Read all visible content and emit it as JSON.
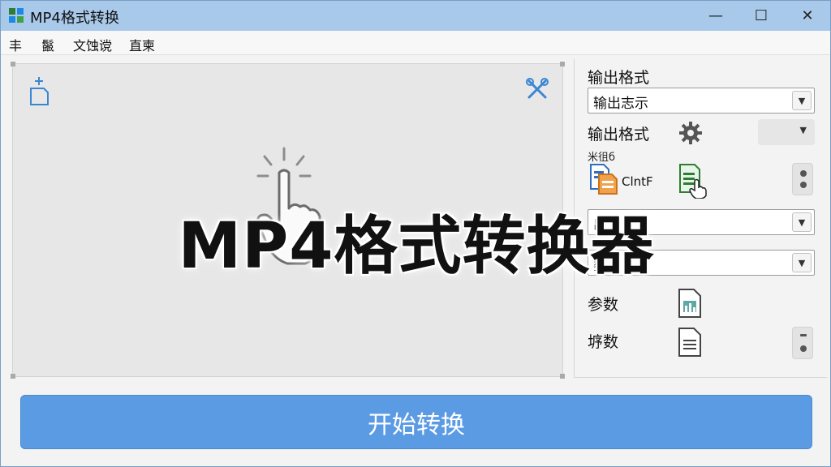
{
  "window": {
    "title": "MP4格式转换",
    "minimize": "—",
    "maximize": "☐",
    "close": "✕"
  },
  "menu": {
    "items": [
      "丰",
      "鬣",
      "文蚀谠",
      "直柬"
    ]
  },
  "panel": {
    "output_format_label": "输出格式",
    "output_format_value": "输出志示",
    "output_format_label_2": "输出格式",
    "small_label": "米徂б",
    "format_option_text": "ClntF",
    "params_label_1": "参数",
    "params_label_2": "垿数",
    "combo_3_text": "出",
    "combo_4_text": "鏊"
  },
  "banner": {
    "text": "MP4格式转换器"
  },
  "actions": {
    "start_label": "开始转换"
  },
  "colors": {
    "titlebar": "#a9c9ea",
    "accent": "#5b9be3",
    "panel_bg": "#f3f3f3",
    "drop_bg": "#e7e7e7"
  },
  "icons": [
    "app-icon",
    "add-file-icon",
    "tools-icon",
    "click-hand-icon",
    "gear-icon",
    "document-icon",
    "spreadsheet-hand-icon",
    "image-file-icon",
    "text-file-icon"
  ]
}
